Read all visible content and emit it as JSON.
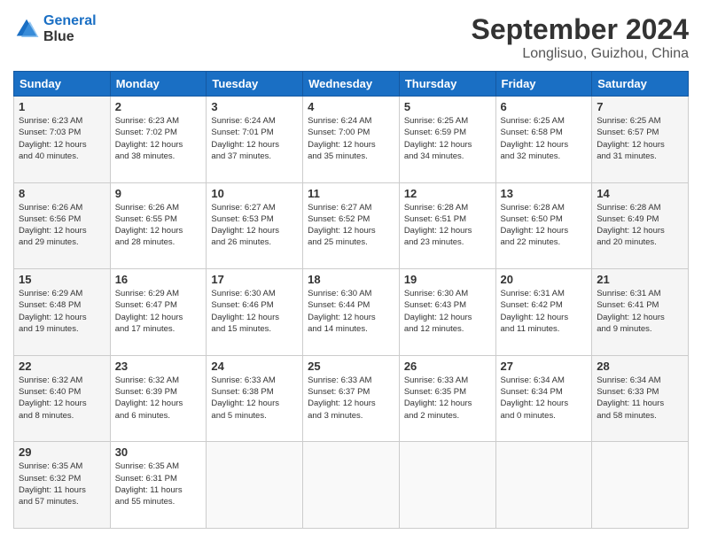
{
  "logo": {
    "line1": "General",
    "line2": "Blue"
  },
  "title": "September 2024",
  "location": "Longlisuo, Guizhou, China",
  "headers": [
    "Sunday",
    "Monday",
    "Tuesday",
    "Wednesday",
    "Thursday",
    "Friday",
    "Saturday"
  ],
  "weeks": [
    [
      {
        "day": "1",
        "info": "Sunrise: 6:23 AM\nSunset: 7:03 PM\nDaylight: 12 hours\nand 40 minutes."
      },
      {
        "day": "2",
        "info": "Sunrise: 6:23 AM\nSunset: 7:02 PM\nDaylight: 12 hours\nand 38 minutes."
      },
      {
        "day": "3",
        "info": "Sunrise: 6:24 AM\nSunset: 7:01 PM\nDaylight: 12 hours\nand 37 minutes."
      },
      {
        "day": "4",
        "info": "Sunrise: 6:24 AM\nSunset: 7:00 PM\nDaylight: 12 hours\nand 35 minutes."
      },
      {
        "day": "5",
        "info": "Sunrise: 6:25 AM\nSunset: 6:59 PM\nDaylight: 12 hours\nand 34 minutes."
      },
      {
        "day": "6",
        "info": "Sunrise: 6:25 AM\nSunset: 6:58 PM\nDaylight: 12 hours\nand 32 minutes."
      },
      {
        "day": "7",
        "info": "Sunrise: 6:25 AM\nSunset: 6:57 PM\nDaylight: 12 hours\nand 31 minutes."
      }
    ],
    [
      {
        "day": "8",
        "info": "Sunrise: 6:26 AM\nSunset: 6:56 PM\nDaylight: 12 hours\nand 29 minutes."
      },
      {
        "day": "9",
        "info": "Sunrise: 6:26 AM\nSunset: 6:55 PM\nDaylight: 12 hours\nand 28 minutes."
      },
      {
        "day": "10",
        "info": "Sunrise: 6:27 AM\nSunset: 6:53 PM\nDaylight: 12 hours\nand 26 minutes."
      },
      {
        "day": "11",
        "info": "Sunrise: 6:27 AM\nSunset: 6:52 PM\nDaylight: 12 hours\nand 25 minutes."
      },
      {
        "day": "12",
        "info": "Sunrise: 6:28 AM\nSunset: 6:51 PM\nDaylight: 12 hours\nand 23 minutes."
      },
      {
        "day": "13",
        "info": "Sunrise: 6:28 AM\nSunset: 6:50 PM\nDaylight: 12 hours\nand 22 minutes."
      },
      {
        "day": "14",
        "info": "Sunrise: 6:28 AM\nSunset: 6:49 PM\nDaylight: 12 hours\nand 20 minutes."
      }
    ],
    [
      {
        "day": "15",
        "info": "Sunrise: 6:29 AM\nSunset: 6:48 PM\nDaylight: 12 hours\nand 19 minutes."
      },
      {
        "day": "16",
        "info": "Sunrise: 6:29 AM\nSunset: 6:47 PM\nDaylight: 12 hours\nand 17 minutes."
      },
      {
        "day": "17",
        "info": "Sunrise: 6:30 AM\nSunset: 6:46 PM\nDaylight: 12 hours\nand 15 minutes."
      },
      {
        "day": "18",
        "info": "Sunrise: 6:30 AM\nSunset: 6:44 PM\nDaylight: 12 hours\nand 14 minutes."
      },
      {
        "day": "19",
        "info": "Sunrise: 6:30 AM\nSunset: 6:43 PM\nDaylight: 12 hours\nand 12 minutes."
      },
      {
        "day": "20",
        "info": "Sunrise: 6:31 AM\nSunset: 6:42 PM\nDaylight: 12 hours\nand 11 minutes."
      },
      {
        "day": "21",
        "info": "Sunrise: 6:31 AM\nSunset: 6:41 PM\nDaylight: 12 hours\nand 9 minutes."
      }
    ],
    [
      {
        "day": "22",
        "info": "Sunrise: 6:32 AM\nSunset: 6:40 PM\nDaylight: 12 hours\nand 8 minutes."
      },
      {
        "day": "23",
        "info": "Sunrise: 6:32 AM\nSunset: 6:39 PM\nDaylight: 12 hours\nand 6 minutes."
      },
      {
        "day": "24",
        "info": "Sunrise: 6:33 AM\nSunset: 6:38 PM\nDaylight: 12 hours\nand 5 minutes."
      },
      {
        "day": "25",
        "info": "Sunrise: 6:33 AM\nSunset: 6:37 PM\nDaylight: 12 hours\nand 3 minutes."
      },
      {
        "day": "26",
        "info": "Sunrise: 6:33 AM\nSunset: 6:35 PM\nDaylight: 12 hours\nand 2 minutes."
      },
      {
        "day": "27",
        "info": "Sunrise: 6:34 AM\nSunset: 6:34 PM\nDaylight: 12 hours\nand 0 minutes."
      },
      {
        "day": "28",
        "info": "Sunrise: 6:34 AM\nSunset: 6:33 PM\nDaylight: 11 hours\nand 58 minutes."
      }
    ],
    [
      {
        "day": "29",
        "info": "Sunrise: 6:35 AM\nSunset: 6:32 PM\nDaylight: 11 hours\nand 57 minutes."
      },
      {
        "day": "30",
        "info": "Sunrise: 6:35 AM\nSunset: 6:31 PM\nDaylight: 11 hours\nand 55 minutes."
      },
      {
        "day": "",
        "info": ""
      },
      {
        "day": "",
        "info": ""
      },
      {
        "day": "",
        "info": ""
      },
      {
        "day": "",
        "info": ""
      },
      {
        "day": "",
        "info": ""
      }
    ]
  ]
}
